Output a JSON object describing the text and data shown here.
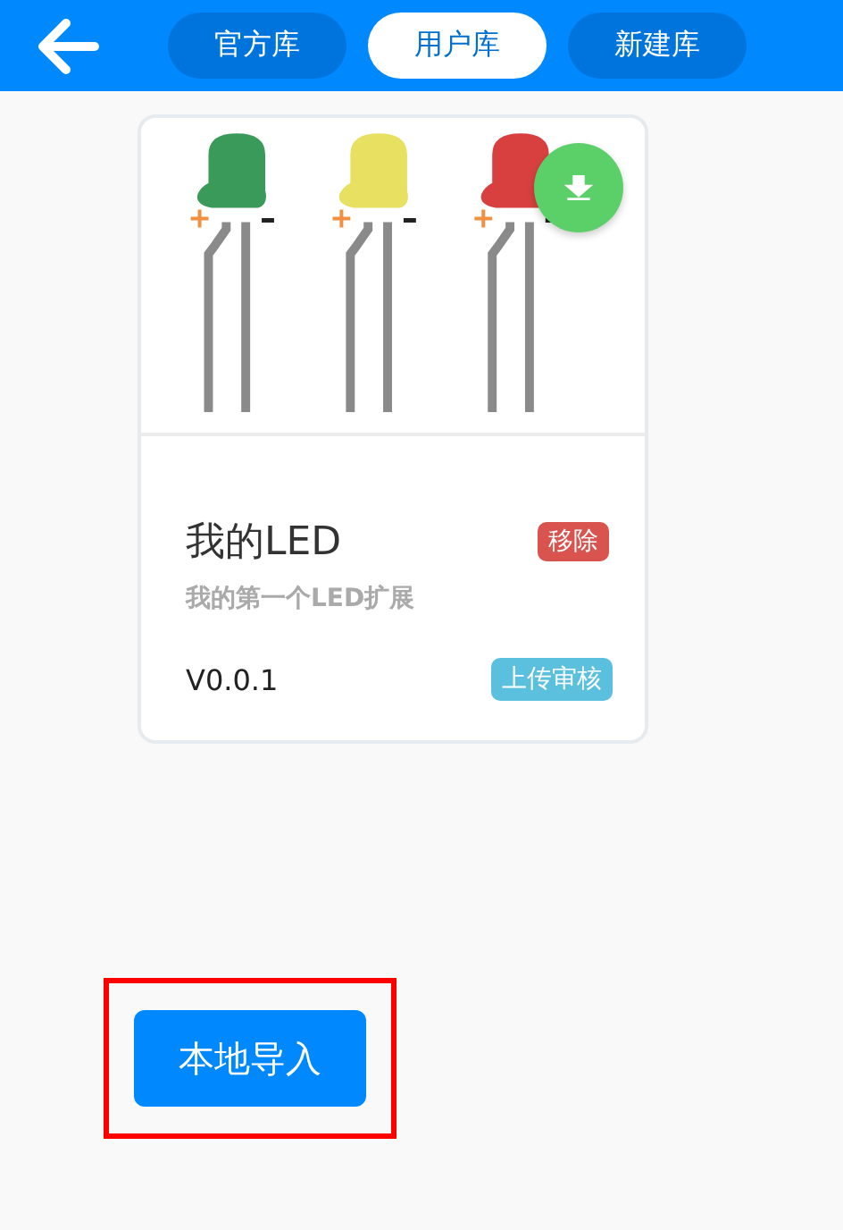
{
  "header": {
    "tabs": [
      {
        "label": "官方库",
        "selected": false
      },
      {
        "label": "用户库",
        "selected": true
      },
      {
        "label": "新建库",
        "selected": false
      }
    ]
  },
  "extensions": [
    {
      "title": "我的LED",
      "remove": "移除",
      "description": "我的第一个LED扩展",
      "version": "V0.0.1",
      "upload": "上传审核"
    }
  ],
  "import_button": {
    "label": "本地导入",
    "highlighted": true
  }
}
